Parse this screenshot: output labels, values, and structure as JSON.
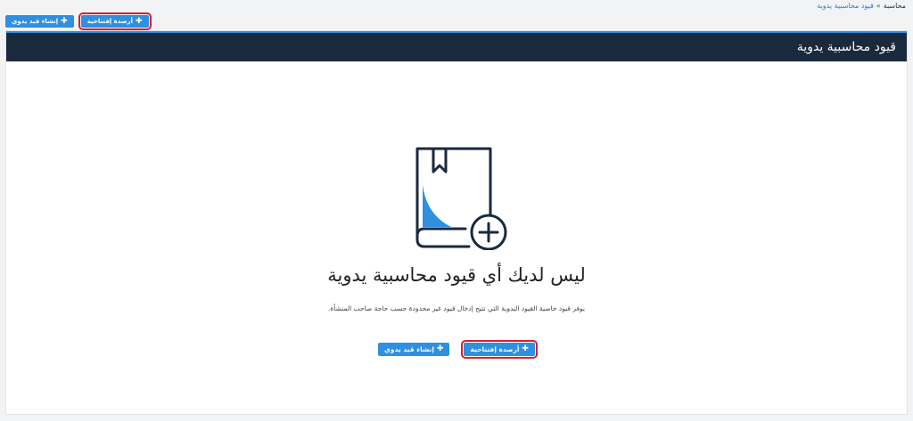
{
  "breadcrumb": {
    "parent": "محاسبة",
    "separator": "»",
    "current": "قيود محاسبية يدوية"
  },
  "actions": {
    "opening_balances_label": "أرصدة إفتتاحية",
    "create_manual_entry_label": "إنشاء قيد يدوي"
  },
  "panel": {
    "title": "قيود محاسبية يدوية"
  },
  "empty_state": {
    "title": "ليس لديك أي قيود محاسبية يدوية",
    "description": "يوفر قيود خاصية القيود اليدوية التي تتيح إدخال قيود غير محدودة حسب حاجة صاحب المنشأة."
  },
  "colors": {
    "primary_button": "#2f8fe0",
    "header_background": "#1a2a3e",
    "highlight_outline": "#d6202f",
    "illustration_accent": "#2f8fe0"
  },
  "icons": {
    "plus": "plus-icon",
    "illustration": "book-add-icon"
  }
}
